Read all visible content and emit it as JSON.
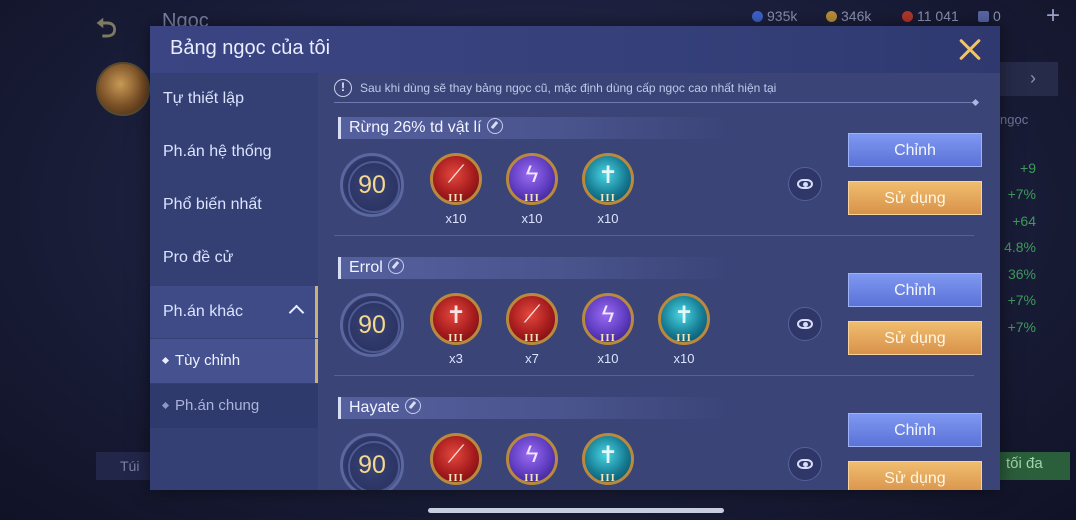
{
  "background": {
    "screen_title": "Ngọc",
    "resources": {
      "blue": "935k",
      "gold": "346k",
      "red": "11 041",
      "tickets": "0"
    },
    "side_label": "ngọc",
    "stats": [
      "+9",
      "+7%",
      "+64",
      "4.8%",
      "36%",
      "+7%",
      "+7%"
    ],
    "bottom_left": "Túi",
    "bottom_right": "tối đa"
  },
  "modal": {
    "title": "Bảng ngọc của tôi",
    "notice": "Sau khi dùng sẽ thay bảng ngọc cũ, mặc định dùng cấp ngọc cao nhất hiện tại"
  },
  "sidebar": {
    "items": [
      {
        "label": "Tự thiết lập"
      },
      {
        "label": "Ph.án hệ thống"
      },
      {
        "label": "Phổ biến nhất"
      },
      {
        "label": "Pro đề cử"
      },
      {
        "label": "Ph.án khác"
      }
    ],
    "subitems": [
      {
        "label": "Tùy chỉnh"
      },
      {
        "label": "Ph.án chung"
      }
    ]
  },
  "sets": [
    {
      "name": "Rừng 26% td vật lí",
      "level": "90",
      "emblems": [
        {
          "color": "red",
          "icon": "dagger-icon",
          "tier": "III",
          "count": "x10"
        },
        {
          "color": "purple",
          "icon": "lightning-icon",
          "tier": "III",
          "count": "x10"
        },
        {
          "color": "teal",
          "icon": "sword-icon",
          "tier": "III",
          "count": "x10"
        }
      ],
      "edit_label": "Chỉnh",
      "use_label": "Sử dụng"
    },
    {
      "name": "Errol",
      "level": "90",
      "emblems": [
        {
          "color": "red",
          "icon": "sword-icon",
          "tier": "III",
          "count": "x3"
        },
        {
          "color": "red",
          "icon": "dagger-icon",
          "tier": "III",
          "count": "x7"
        },
        {
          "color": "purple",
          "icon": "lightning-icon",
          "tier": "III",
          "count": "x10"
        },
        {
          "color": "teal",
          "icon": "sword-icon",
          "tier": "III",
          "count": "x10"
        }
      ],
      "edit_label": "Chỉnh",
      "use_label": "Sử dụng"
    },
    {
      "name": "Hayate",
      "level": "90",
      "emblems": [
        {
          "color": "red",
          "icon": "dagger-icon",
          "tier": "III",
          "count": ""
        },
        {
          "color": "purple",
          "icon": "lightning-icon",
          "tier": "III",
          "count": ""
        },
        {
          "color": "teal",
          "icon": "sword-icon",
          "tier": "III",
          "count": ""
        }
      ],
      "edit_label": "Chỉnh",
      "use_label": "Sử dụng"
    }
  ]
}
